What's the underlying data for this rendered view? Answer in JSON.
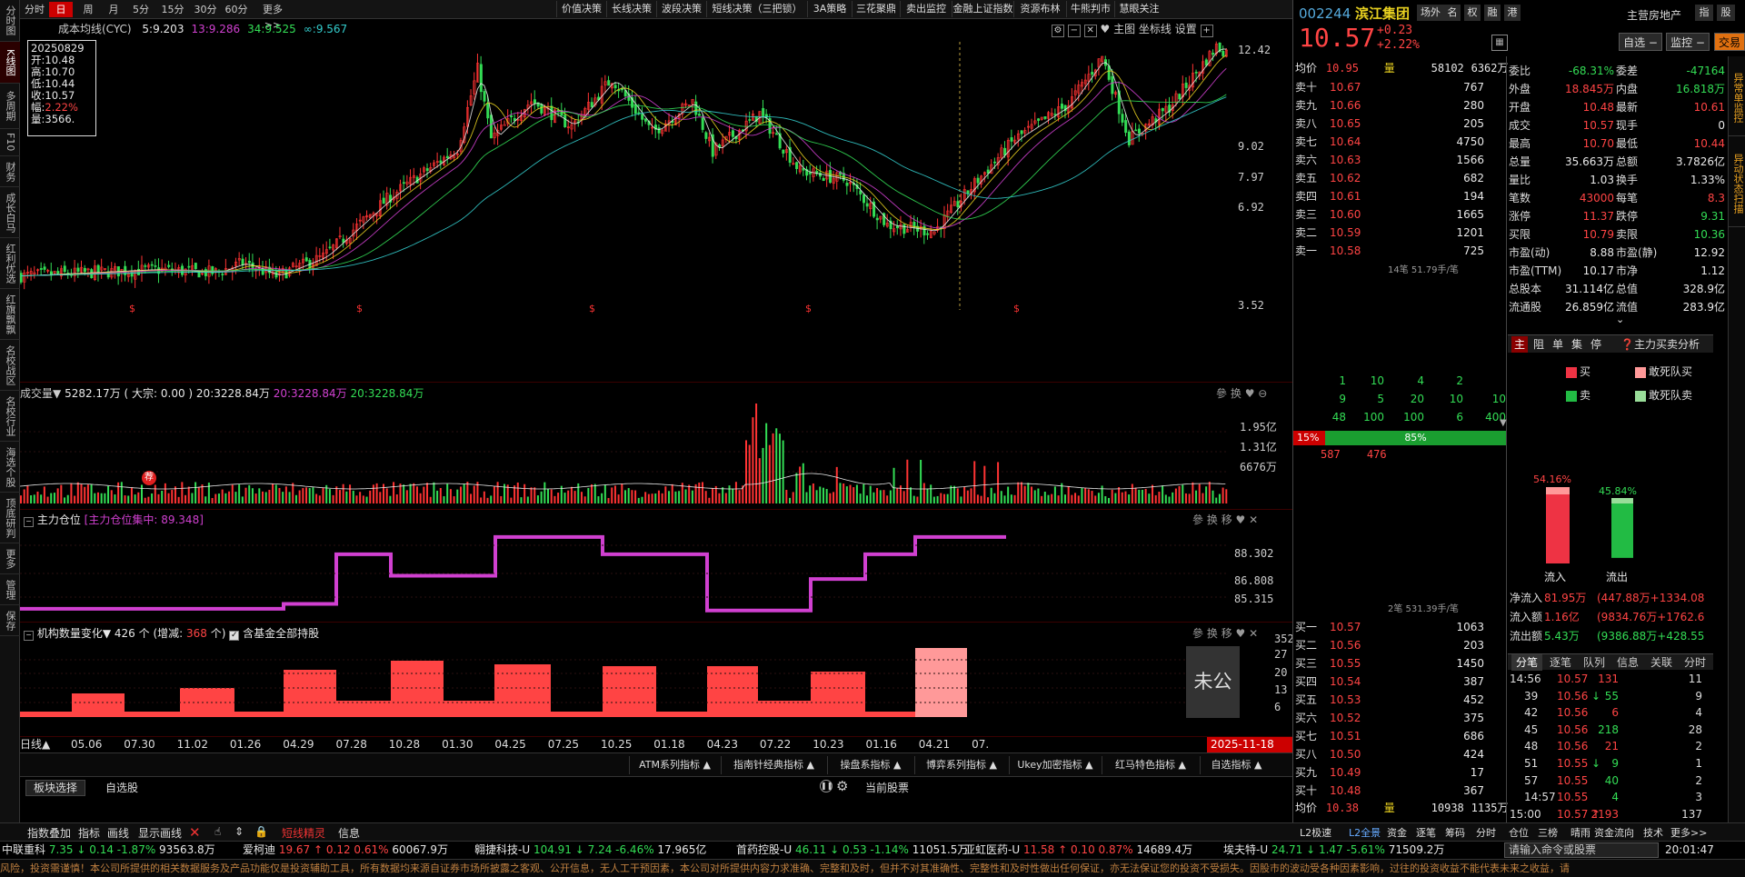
{
  "left_tabs": [
    "分时图",
    "K线图",
    "多周期",
    "F10",
    "财务",
    "成长白马",
    "红利优选",
    "红旗飘飘",
    "名校战区",
    "名校行业",
    "海选个股",
    "顶底研判",
    "更多",
    "管理",
    "保存"
  ],
  "toolbar": {
    "periods": [
      "分时",
      "日",
      "周",
      "月",
      "5分",
      "15分",
      "30分",
      "60分",
      "更多>>"
    ],
    "active_period": "日",
    "strategies": [
      "价值决策",
      "长线决策",
      "波段决策",
      "短线决策（三把锁）",
      "3A策略",
      "三花聚鼎",
      "卖出监控",
      "金融上证指数",
      "资源布林",
      "牛熊判市",
      "慧眼关注"
    ]
  },
  "kline": {
    "title": "成本均线(CYC)",
    "ma_labels": [
      {
        "text": "5:9.203",
        "color": "#e8e8e8"
      },
      {
        "text": "13:9.286",
        "color": "#d040d0"
      },
      {
        "text": "34:9.525",
        "color": "#33dd55"
      },
      {
        "text": "∞:9.567",
        "color": "#33cccc"
      }
    ],
    "controls": [
      "主图",
      "坐标线",
      "设置"
    ],
    "y_ticks": [
      "12.42",
      "9.02",
      "7.97",
      "6.92",
      "3.52"
    ],
    "tooltip": {
      "date": "20250829",
      "rows": [
        {
          "k": "开:",
          "v": "10.48",
          "c": "#e8e8e8"
        },
        {
          "k": "高:",
          "v": "10.70",
          "c": "#e8e8e8"
        },
        {
          "k": "低:",
          "v": "10.44",
          "c": "#e8e8e8"
        },
        {
          "k": "收:",
          "v": "10.57",
          "c": "#e8e8e8"
        },
        {
          "k": "幅:",
          "v": "2.22%",
          "c": "#ff4444"
        },
        {
          "k": "量:",
          "v": "3566.",
          "c": "#e8e8e8"
        }
      ]
    }
  },
  "volume": {
    "title": "成交量▼",
    "value": "5282.17万",
    "bulk": "( 大宗: 0.00 )",
    "ma1": "20:3228.84万",
    "ma2": "20:3228.84万",
    "ma3": "20:3228.84万",
    "y_ticks": [
      "1.95亿",
      "1.31亿",
      "6676万"
    ],
    "badge": "荐"
  },
  "main_position": {
    "title": "主力仓位",
    "label": "[主力仓位集中: 89.348]",
    "y_ticks": [
      "88.302",
      "86.808",
      "85.315"
    ]
  },
  "institutions": {
    "title": "机构数量变化▼",
    "count": "426 个",
    "change_label": "(增减:",
    "change": "368",
    "change_unit": "个)",
    "checkbox_label": "含基金全部持股",
    "y_ticks": [
      "352",
      "27",
      "20",
      "13",
      "6"
    ],
    "unpublished": "未公布"
  },
  "xaxis": {
    "period_label": "日线▲",
    "labels": [
      "05.06",
      "07.30",
      "11.02",
      "01.26",
      "04.29",
      "07.28",
      "10.28",
      "01.30",
      "04.25",
      "07.25",
      "10.25",
      "01.18",
      "04.23",
      "07.22",
      "10.23",
      "01.16",
      "04.21",
      "07."
    ],
    "current_date": "2025-11-18"
  },
  "indicator_tabs": [
    "ATM系列指标 ▲",
    "指南针经典指标 ▲",
    "操盘系指标 ▲",
    "博弈系列指标 ▲",
    "Ukey加密指标 ▲",
    "红马特色指标 ▲",
    "自选指标 ▲"
  ],
  "board_tabs": [
    "板块选择",
    "自选股"
  ],
  "board_right": "当前股票",
  "chart_data": [
    {
      "type": "bar",
      "title": "机构数量变化",
      "categories": [
        "05.06",
        "07.30",
        "11.02",
        "01.26",
        "04.29",
        "07.28",
        "10.28",
        "01.30",
        "04.25",
        "07.25",
        "10.25",
        "01.18",
        "04.23",
        "07.22",
        "10.23",
        "01.16",
        "04.21"
      ],
      "values": [
        6,
        20,
        6,
        27,
        6,
        40,
        13,
        60,
        13,
        50,
        6,
        48,
        6,
        46,
        13,
        40,
        6,
        352
      ],
      "ylim": [
        0,
        352
      ]
    },
    {
      "type": "line",
      "title": "主力仓位",
      "x": [
        0,
        1,
        2,
        3,
        4,
        5,
        6,
        7,
        8,
        9,
        10,
        11,
        12,
        13,
        14,
        15,
        16
      ],
      "values": [
        85.0,
        85.0,
        85.05,
        85.3,
        88.3,
        87.0,
        87.0,
        89.35,
        89.35,
        88.3,
        88.3,
        84.9,
        84.9,
        86.8,
        86.8,
        88.3,
        89.35
      ],
      "ylim": [
        84.5,
        90
      ]
    }
  ],
  "quote": {
    "code": "002244",
    "name": "滨江集团",
    "buttons": [
      "场外",
      "名",
      "权",
      "融",
      "港"
    ],
    "sector": "主营房地产",
    "sector_buttons": [
      "指",
      "股"
    ],
    "price": "10.57",
    "change": "+0.23",
    "change_pct": "+2.22%",
    "mini_buttons": [
      "自选",
      "监控",
      "交易"
    ],
    "avg_label": "均价",
    "avg_price": "10.95",
    "volume_label": "量",
    "volume_top": "58102",
    "volume_top2": "6362万",
    "asks": [
      {
        "label": "卖十",
        "price": "10.67",
        "vol": "767"
      },
      {
        "label": "卖九",
        "price": "10.66",
        "vol": "280"
      },
      {
        "label": "卖八",
        "price": "10.65",
        "vol": "205"
      },
      {
        "label": "卖七",
        "price": "10.64",
        "vol": "4750"
      },
      {
        "label": "卖六",
        "price": "10.63",
        "vol": "1566"
      },
      {
        "label": "卖五",
        "price": "10.62",
        "vol": "682"
      },
      {
        "label": "卖四",
        "price": "10.61",
        "vol": "194"
      },
      {
        "label": "卖三",
        "price": "10.60",
        "vol": "1665"
      },
      {
        "label": "卖二",
        "price": "10.59",
        "vol": "1201"
      },
      {
        "label": "卖一",
        "price": "10.58",
        "vol": "725"
      }
    ],
    "ask_summary": "14笔 51.79手/笔",
    "queue_rows": [
      [
        "1",
        "10",
        "4",
        "2",
        ""
      ],
      [
        "9",
        "5",
        "20",
        "10",
        "10"
      ],
      [
        "48",
        "100",
        "100",
        "6",
        "400"
      ]
    ],
    "ratio_left": "15%",
    "ratio_right": "85%",
    "ratio_values": [
      "587",
      "476"
    ],
    "bid_summary": "2笔 531.39手/笔",
    "bids": [
      {
        "label": "买一",
        "price": "10.57",
        "vol": "1063"
      },
      {
        "label": "买二",
        "price": "10.56",
        "vol": "203"
      },
      {
        "label": "买三",
        "price": "10.55",
        "vol": "1450"
      },
      {
        "label": "买四",
        "price": "10.54",
        "vol": "387"
      },
      {
        "label": "买五",
        "price": "10.53",
        "vol": "452"
      },
      {
        "label": "买六",
        "price": "10.52",
        "vol": "375"
      },
      {
        "label": "买七",
        "price": "10.51",
        "vol": "686"
      },
      {
        "label": "买八",
        "price": "10.50",
        "vol": "424"
      },
      {
        "label": "买九",
        "price": "10.49",
        "vol": "17"
      },
      {
        "label": "买十",
        "price": "10.48",
        "vol": "367"
      }
    ],
    "bottom_avg_label": "均价",
    "bottom_avg": "10.38",
    "bottom_vol_label": "量",
    "bottom_vol": "10938",
    "bottom_vol2": "1135万",
    "stats": [
      {
        "l1": "委比",
        "v1": "-68.31%",
        "c1": "#33dd55",
        "l2": "委差",
        "v2": "-47164",
        "c2": "#33dd55"
      },
      {
        "l1": "外盘",
        "v1": "18.845万",
        "c1": "#ff4444",
        "l2": "内盘",
        "v2": "16.818万",
        "c2": "#33dd55"
      },
      {
        "l1": "开盘",
        "v1": "10.48",
        "c1": "#ff4444",
        "l2": "最新",
        "v2": "10.61",
        "c2": "#ff4444"
      },
      {
        "l1": "成交",
        "v1": "10.57",
        "c1": "#ff4444",
        "l2": "现手",
        "v2": "0",
        "c2": "#e8e8e8"
      },
      {
        "l1": "最高",
        "v1": "10.70",
        "c1": "#ff4444",
        "l2": "最低",
        "v2": "10.44",
        "c2": "#ff4444"
      },
      {
        "l1": "总量",
        "v1": "35.663万",
        "c1": "#e8e8e8",
        "l2": "总额",
        "v2": "3.7826亿",
        "c2": "#e8e8e8"
      },
      {
        "l1": "量比",
        "v1": "1.03",
        "c1": "#e8e8e8",
        "l2": "换手",
        "v2": "1.33%",
        "c2": "#e8e8e8"
      },
      {
        "l1": "笔数",
        "v1": "43000",
        "c1": "#ff4444",
        "l2": "每笔",
        "v2": "8.3",
        "c2": "#ff4444"
      },
      {
        "l1": "涨停",
        "v1": "11.37",
        "c1": "#ff4444",
        "l2": "跌停",
        "v2": "9.31",
        "c2": "#33dd55"
      },
      {
        "l1": "买限",
        "v1": "10.79",
        "c1": "#ff4444",
        "l2": "卖限",
        "v2": "10.36",
        "c2": "#33dd55"
      },
      {
        "l1": "市盈(动)",
        "v1": "8.88",
        "c1": "#e8e8e8",
        "l2": "市盈(静)",
        "v2": "12.92",
        "c2": "#e8e8e8"
      },
      {
        "l1": "市盈(TTM)",
        "v1": "10.17",
        "c1": "#e8e8e8",
        "l2": "市净",
        "v2": "1.12",
        "c2": "#e8e8e8"
      },
      {
        "l1": "总股本",
        "v1": "31.114亿",
        "c1": "#e8e8e8",
        "l2": "总值",
        "v2": "328.9亿",
        "c2": "#e8e8e8"
      },
      {
        "l1": "流通股",
        "v1": "26.859亿",
        "c1": "#e8e8e8",
        "l2": "流值",
        "v2": "283.9亿",
        "c2": "#e8e8e8"
      }
    ],
    "flow_tabs": [
      "主",
      "阻",
      "单",
      "集",
      "停"
    ],
    "flow_analysis": "主力买卖分析",
    "legend": [
      {
        "label": "买",
        "color": "#ee3344"
      },
      {
        "label": "敢死队买",
        "color": "#ff9999"
      },
      {
        "label": "卖",
        "color": "#22bb44"
      },
      {
        "label": "敢死队卖",
        "color": "#99dd99"
      }
    ],
    "inflow_pct": "54.16%",
    "outflow_pct": "45.84%",
    "inflow_label": "流入",
    "outflow_label": "流出",
    "inflow_ratio": 0.5416,
    "outflow_ratio": 0.4584,
    "net": [
      {
        "label": "净流入",
        "v1": "81.95万",
        "v2": "447.88万+1334.08",
        "c": "#ff4444"
      },
      {
        "label": "流入额",
        "v1": "1.16亿",
        "v2": "9834.76万+1762.6",
        "c": "#ff4444"
      },
      {
        "label": "流出额",
        "v1": "5.43万",
        "v2": "9386.88万+428.55",
        "c": "#33dd55"
      }
    ],
    "trade_tabs": [
      "分笔",
      "逐笔",
      "队列",
      "信息",
      "关联",
      "分时"
    ],
    "trades": [
      {
        "t": "14:56",
        "p": "10.57",
        "arrow": "",
        "v": "131",
        "n": "11",
        "pc": "#ff4444",
        "vc": "#ff4444"
      },
      {
        "t": "39",
        "p": "10.56",
        "arrow": "↓",
        "v": "55",
        "n": "9",
        "pc": "#ff4444",
        "vc": "#33dd55"
      },
      {
        "t": "42",
        "p": "10.56",
        "arrow": "",
        "v": "6",
        "n": "4",
        "pc": "#ff4444",
        "vc": "#ff4444"
      },
      {
        "t": "45",
        "p": "10.56",
        "arrow": "",
        "v": "218",
        "n": "28",
        "pc": "#ff4444",
        "vc": "#33dd55"
      },
      {
        "t": "48",
        "p": "10.56",
        "arrow": "",
        "v": "21",
        "n": "2",
        "pc": "#ff4444",
        "vc": "#ff4444"
      },
      {
        "t": "51",
        "p": "10.55",
        "arrow": "↓",
        "v": "9",
        "n": "1",
        "pc": "#ff4444",
        "vc": "#33dd55"
      },
      {
        "t": "57",
        "p": "10.55",
        "arrow": "",
        "v": "40",
        "n": "2",
        "pc": "#ff4444",
        "vc": "#33dd55"
      },
      {
        "t": "14:57",
        "p": "10.55",
        "arrow": "",
        "v": "4",
        "n": "3",
        "pc": "#ff4444",
        "vc": "#33dd55"
      },
      {
        "t": "15:00",
        "p": "10.57",
        "arrow": "↑",
        "v": "2193",
        "n": "137",
        "pc": "#ff4444",
        "vc": "#ff4444"
      }
    ],
    "side_tabs": [
      "异常单监控",
      "异动状态扫描"
    ]
  },
  "bottom_tabs": [
    "指数叠加",
    "指标",
    "画线",
    "显示画线"
  ],
  "bottom_right_tabs": [
    "短线精灵",
    "信息"
  ],
  "bottom_quote_tabs": [
    "L2极速",
    "L2全景",
    "资金",
    "逐笔",
    "筹码",
    "分时",
    "仓位",
    "三榜",
    "晴雨",
    "资金流向",
    "技术",
    "更多>>"
  ],
  "tickers": [
    {
      "name": "中联重科",
      "price": "7.35",
      "chg": "0.14",
      "pct": "-1.87%",
      "amt": "93563.8万",
      "dir": "down"
    },
    {
      "name": "爱柯迪",
      "price": "19.67",
      "chg": "0.12",
      "pct": "0.61%",
      "amt": "60067.9万",
      "dir": "up"
    },
    {
      "name": "翱捷科技-U",
      "price": "104.91",
      "chg": "7.24",
      "pct": "-6.46%",
      "amt": "17.965亿",
      "dir": "down"
    },
    {
      "name": "首药控股-U",
      "price": "46.11",
      "chg": "0.53",
      "pct": "-1.14%",
      "amt": "11051.5万",
      "dir": "down"
    },
    {
      "name": "亚虹医药-U",
      "price": "11.58",
      "chg": "0.10",
      "pct": "0.87%",
      "amt": "14689.4万",
      "dir": "up"
    },
    {
      "name": "埃夫特-U",
      "price": "24.71",
      "chg": "1.47",
      "pct": "-5.61%",
      "amt": "71509.2万",
      "dir": "down"
    }
  ],
  "command_placeholder": "请输入命令或股票",
  "clock": "20:01:47",
  "disclaimer": "风险，投资需谨慎！本公司所提供的相关数据服务及产品功能仅是投资辅助工具，所有数据均来源自证券市场所披露之客观、公开信息，无人工干预因素，本公司对所提供内容力求准确、完整和及时，但并不对其准确性、完整性和及时性做出任何保证，亦无法保证您的投资不受损失。因股市的波动受各种因素影响，过往的投资收益不能代表未来之收益，请"
}
